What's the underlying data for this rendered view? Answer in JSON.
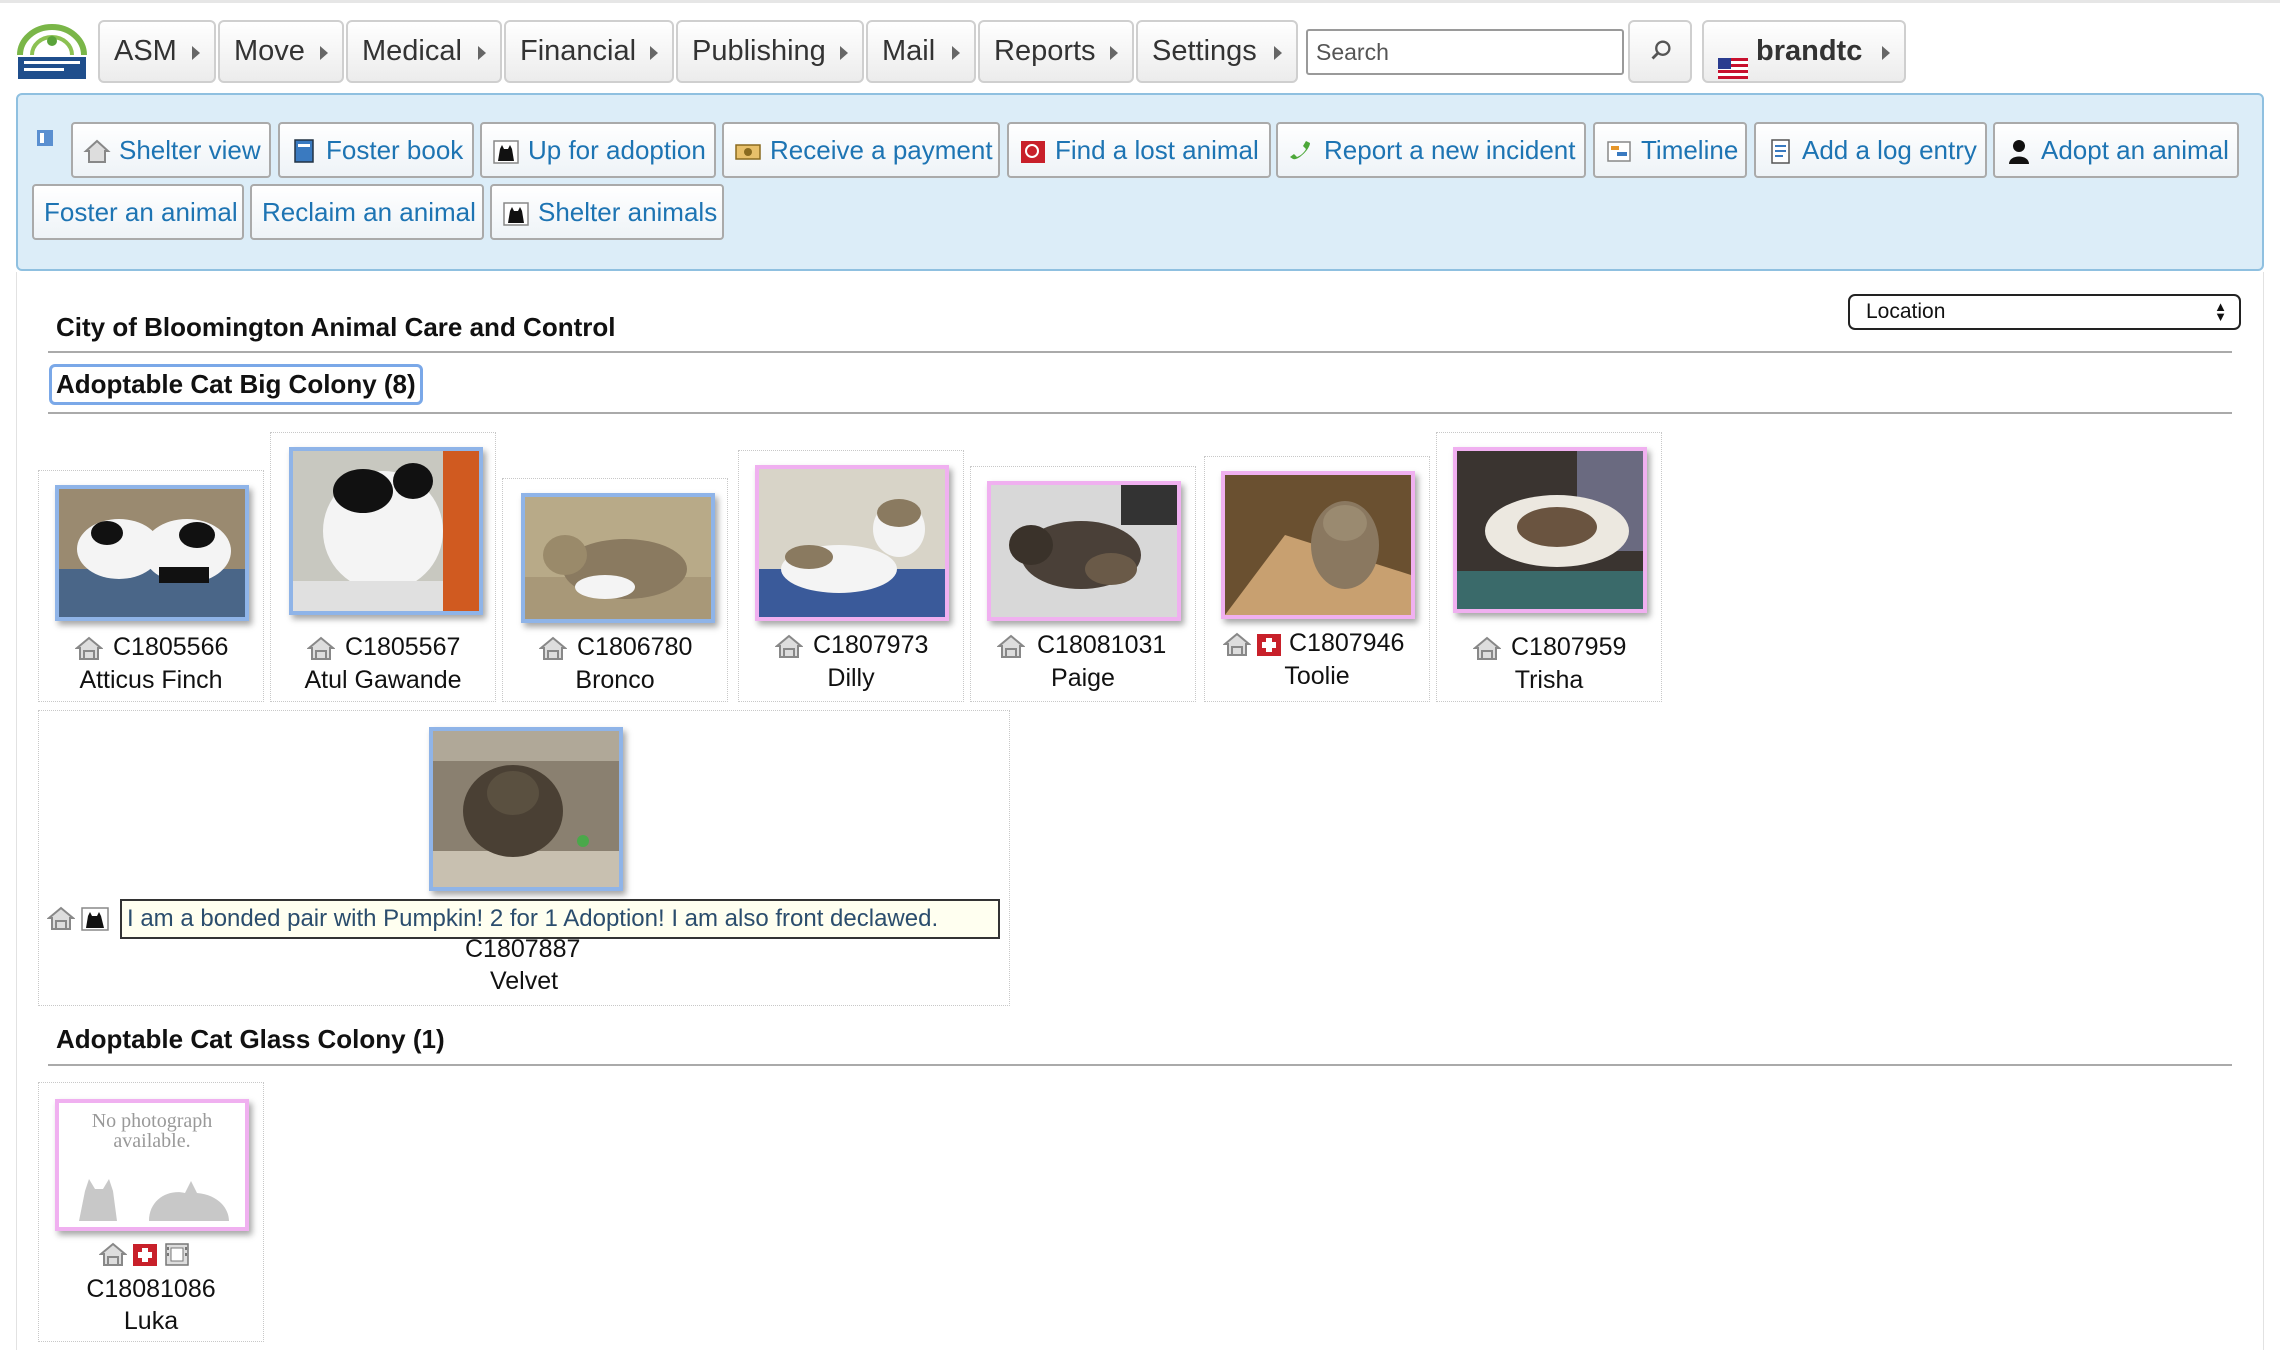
{
  "topbar": {
    "menus": [
      "ASM",
      "Move",
      "Medical",
      "Financial",
      "Publishing",
      "Mail",
      "Reports",
      "Settings"
    ],
    "search_placeholder": "Search",
    "user": "brandtc"
  },
  "quicklinks": {
    "row1": [
      "Shelter view",
      "Foster book",
      "Up for adoption",
      "Receive a payment",
      "Find a lost animal",
      "Report a new incident",
      "Timeline",
      "Add a log entry",
      "Adopt an animal"
    ],
    "row2": [
      "Foster an animal",
      "Reclaim an animal",
      "Shelter animals"
    ]
  },
  "main": {
    "org_title": "City of Bloomington Animal Care and Control",
    "sort_select": "Location",
    "colonies": [
      {
        "heading": "Adoptable Cat Big Colony (8)",
        "animals": [
          {
            "code": "C1805566",
            "name": "Atticus Finch",
            "sex": "male",
            "icons": [
              "house-icon"
            ]
          },
          {
            "code": "C1805567",
            "name": "Atul Gawande",
            "sex": "male",
            "icons": [
              "house-icon"
            ]
          },
          {
            "code": "C1806780",
            "name": "Bronco",
            "sex": "male",
            "icons": [
              "house-icon"
            ]
          },
          {
            "code": "C1807973",
            "name": "Dilly",
            "sex": "female",
            "icons": [
              "house-icon"
            ]
          },
          {
            "code": "C18081031",
            "name": "Paige",
            "sex": "female",
            "icons": [
              "house-icon"
            ]
          },
          {
            "code": "C1807946",
            "name": "Toolie",
            "sex": "female",
            "icons": [
              "house-icon",
              "medical-icon"
            ]
          },
          {
            "code": "C1807959",
            "name": "Trisha",
            "sex": "female",
            "icons": [
              "house-icon"
            ]
          },
          {
            "code": "C1807887",
            "name": "Velvet",
            "sex": "male",
            "icons": [
              "house-icon",
              "cat-icon"
            ],
            "caption": "I am a bonded pair with Pumpkin! 2 for 1 Adoption! I am also front declawed."
          }
        ]
      },
      {
        "heading": "Adoptable Cat Glass Colony (1)",
        "animals": [
          {
            "code": "C18081086",
            "name": "Luka",
            "sex": "female",
            "icons": [
              "house-icon",
              "medical-icon",
              "film-icon"
            ],
            "no_photo_text": "No photograph available."
          }
        ]
      }
    ]
  },
  "colors": {
    "link": "#1d74b3",
    "panel_bg": "#dcedf8",
    "panel_border": "#8fc0e0",
    "male_frame": "#8fb4e8",
    "female_frame": "#f0b0f0"
  }
}
